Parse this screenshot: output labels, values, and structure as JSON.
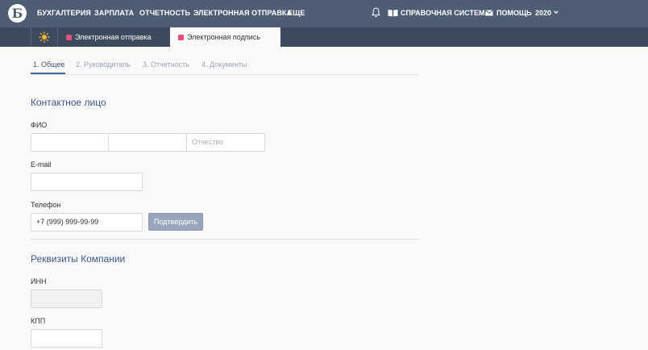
{
  "app": {
    "logo_letter": "Б"
  },
  "nav": {
    "items": [
      "БУХГАЛТЕРИЯ",
      "ЗАРПЛАТА",
      "ОТЧЕТНОСТЬ",
      "ЭЛЕКТРОННАЯ ОТПРАВКА",
      "ЕЩЕ"
    ],
    "notifications_icon": "bell-icon",
    "help_system": {
      "icon": "book-icon",
      "label": "СПРАВОЧНАЯ СИСТЕМА"
    },
    "help": {
      "icon": "mail-icon",
      "label": "ПОМОЩЬ"
    },
    "year": "2020"
  },
  "tabs": {
    "home_icon": "sun-icon",
    "items": [
      {
        "label": "Электронная отправка",
        "active": false,
        "marker_color": "#e4517f"
      },
      {
        "label": "Электронная подпись",
        "active": true,
        "marker_color": "#e4517f"
      }
    ]
  },
  "steps": [
    {
      "label": "1. Общее",
      "active": true
    },
    {
      "label": "2. Руководитель",
      "active": false
    },
    {
      "label": "3. Отчетность",
      "active": false
    },
    {
      "label": "4. Документы",
      "active": false
    }
  ],
  "contact": {
    "title": "Контактное лицо",
    "fio_label": "ФИО",
    "fio_fields": [
      {
        "value": "",
        "placeholder": ""
      },
      {
        "value": "",
        "placeholder": ""
      },
      {
        "value": "",
        "placeholder": "Отчество"
      }
    ],
    "email_label": "E-mail",
    "email_value": "",
    "phone_label": "Телефон",
    "phone_value": "+7 (999) 999-99-99",
    "confirm_button": "Подтвердить"
  },
  "company": {
    "title": "Реквизиты Компании",
    "inn_label": "ИНН",
    "inn_value": "",
    "kpp_label": "КПП",
    "kpp_value": ""
  },
  "colors": {
    "topbar": "#4f5d74",
    "tabstrip": "#3d4a5d",
    "accent": "#3d6ba1",
    "tab_marker": "#e4517f",
    "button": "#99a5bb"
  }
}
